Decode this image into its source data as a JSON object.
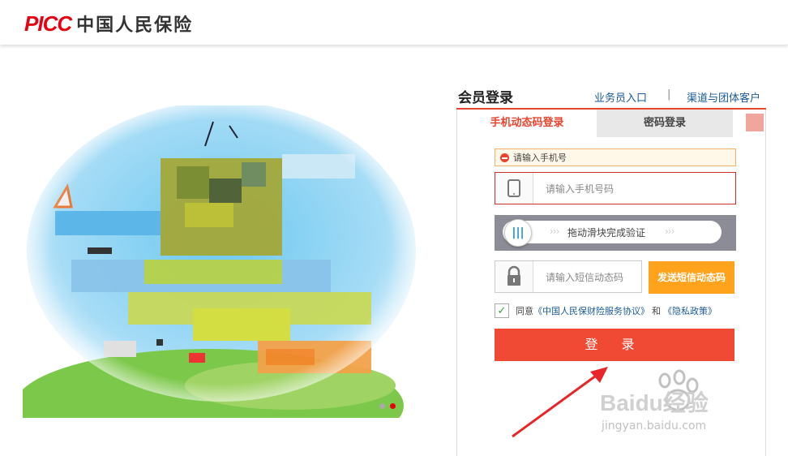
{
  "header": {
    "brand": "PICC",
    "company_name": "中国人民保险"
  },
  "login": {
    "title": "会员登录",
    "link_staff": "业务员入口",
    "separator": "|",
    "link_channel": "渠道与团体客户",
    "tabs": [
      {
        "label": "手机动态码登录",
        "active": true
      },
      {
        "label": "密码登录",
        "active": false
      }
    ],
    "error_tip": "请输入手机号",
    "phone_placeholder": "请输入手机号码",
    "slider_text": "拖动滑块完成验证",
    "slider_knob": "|||",
    "sms_placeholder": "请输入短信动态码",
    "send_sms_label": "发送短信动态码",
    "agree_prefix": "同意",
    "agree_link1": "《中国人民保财险服务协议》",
    "agree_and": "和",
    "agree_link2": "《隐私政策》",
    "login_label": "登 录"
  },
  "watermark": {
    "brand": "Baidu经验",
    "url": "jingyan.baidu.com"
  },
  "colors": {
    "brand_red": "#e60012",
    "accent_red": "#e8442e",
    "login_button": "#f04a35",
    "sms_button": "#ffa21c",
    "link_blue": "#1a5a96"
  }
}
